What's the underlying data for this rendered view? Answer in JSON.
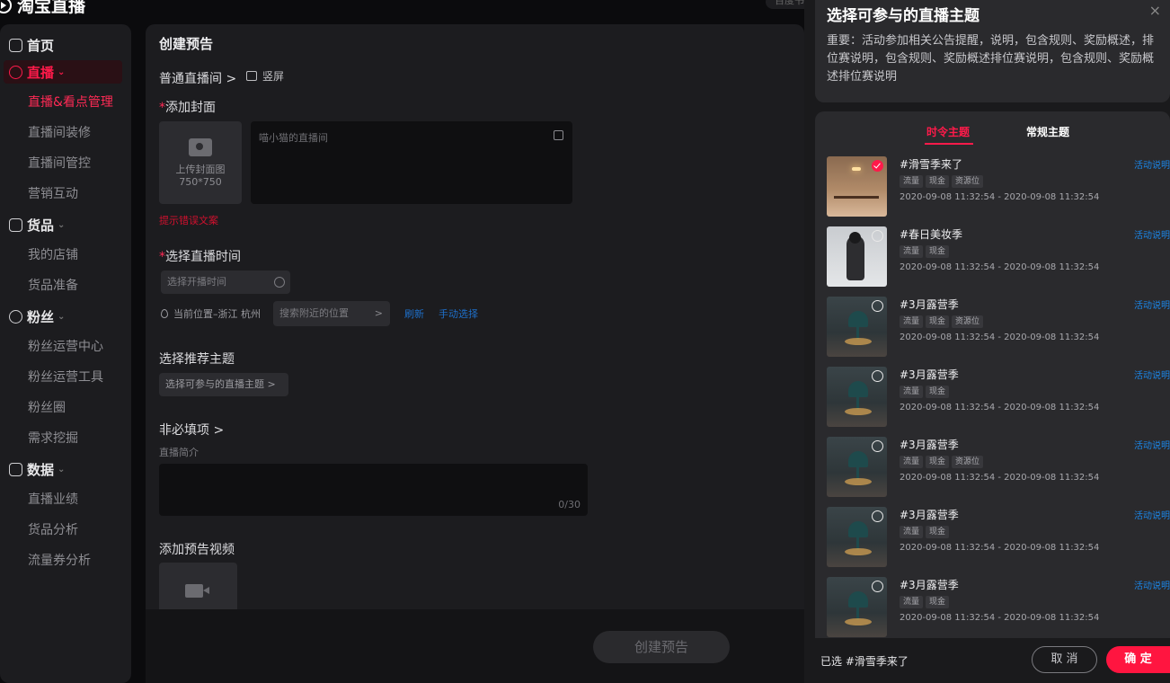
{
  "app": {
    "logo": "淘宝直播",
    "top_right": "百度书"
  },
  "sidebar": {
    "home": "首页",
    "live_group": "直播",
    "live_items": [
      "直播&看点管理",
      "直播间装修",
      "直播间管控",
      "营销互动"
    ],
    "goods_group": "货品",
    "goods_items": [
      "我的店铺",
      "货品准备"
    ],
    "fans_group": "粉丝",
    "fans_items": [
      "粉丝运营中心",
      "粉丝运营工具",
      "粉丝圈",
      "需求挖掘"
    ],
    "data_group": "数据",
    "data_items": [
      "直播业绩",
      "货品分析",
      "流量券分析"
    ]
  },
  "form": {
    "title": "创建预告",
    "room_type": "普通直播间 >",
    "orientation": "竖屏",
    "cover_label": "添加封面",
    "cover_upload": "上传封面图",
    "cover_size": "750*750",
    "title_placeholder": "喵小猫的直播间",
    "error_text": "提示错误文案",
    "time_label": "选择直播时间",
    "time_placeholder": "选择开播时间",
    "location": "当前位置–浙江 杭州",
    "location_search": "搜索附近的位置",
    "refresh": "刷新",
    "manual_select": "手动选择",
    "topic_label": "选择推荐主题",
    "topic_button": "选择可参与的直播主题 >",
    "optional": "非必填项 >",
    "intro_label": "直播简介",
    "intro_count": "0/30",
    "video_label": "添加预告视频",
    "create_button": "创建预告"
  },
  "drawer": {
    "title": "选择可参与的直播主题",
    "close": "×",
    "notice": "重要：活动参加相关公告提醒，说明，包含规则、奖励概述，排位赛说明，包含规则、奖励概述排位赛说明，包含规则、奖励概述排位赛说明",
    "tabs": [
      "时令主题",
      "常规主题"
    ],
    "activity_link": "活动说明",
    "items": [
      {
        "title": "#滑雪季来了",
        "tags": [
          "流量",
          "现金",
          "资源位"
        ],
        "time": "2020-09-08 11:32:54 - 2020-09-08 11:32:54",
        "thumb": "room",
        "selected": true
      },
      {
        "title": "#春日美妆季",
        "tags": [
          "流量",
          "现金"
        ],
        "time": "2020-09-08 11:32:54 - 2020-09-08 11:32:54",
        "thumb": "person",
        "selected": false
      },
      {
        "title": "#3月露营季",
        "tags": [
          "流量",
          "现金",
          "资源位"
        ],
        "time": "2020-09-08 11:32:54 - 2020-09-08 11:32:54",
        "thumb": "lamp",
        "selected": false
      },
      {
        "title": "#3月露营季",
        "tags": [
          "流量",
          "现金"
        ],
        "time": "2020-09-08 11:32:54 - 2020-09-08 11:32:54",
        "thumb": "lamp",
        "selected": false
      },
      {
        "title": "#3月露营季",
        "tags": [
          "流量",
          "现金",
          "资源位"
        ],
        "time": "2020-09-08 11:32:54 - 2020-09-08 11:32:54",
        "thumb": "lamp",
        "selected": false
      },
      {
        "title": "#3月露营季",
        "tags": [
          "流量",
          "现金"
        ],
        "time": "2020-09-08 11:32:54 - 2020-09-08 11:32:54",
        "thumb": "lamp",
        "selected": false
      },
      {
        "title": "#3月露营季",
        "tags": [
          "流量",
          "现金"
        ],
        "time": "2020-09-08 11:32:54 - 2020-09-08 11:32:54",
        "thumb": "lamp",
        "selected": false
      }
    ],
    "selected_text": "已选 #滑雪季来了",
    "cancel": "取 消",
    "confirm": "确 定"
  },
  "colors": {
    "accent": "#ff1a4a",
    "link": "#1b86e8",
    "panel": "#1c1c1f"
  }
}
